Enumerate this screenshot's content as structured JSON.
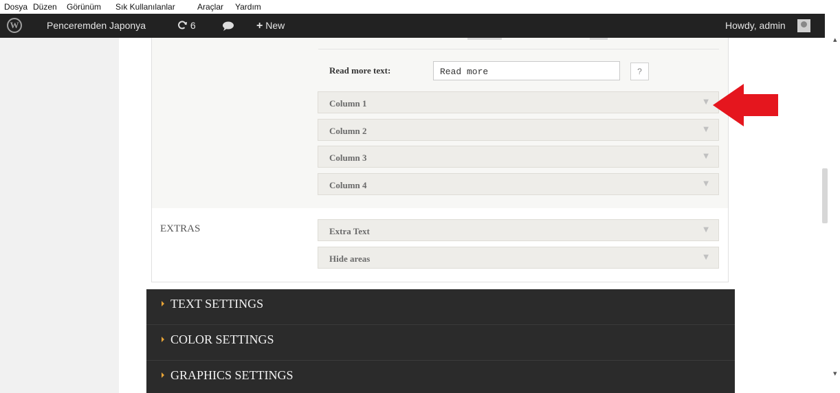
{
  "menubar": {
    "items": [
      "Dosya",
      "Düzen",
      "Görünüm",
      "Sık Kullanılanlar",
      "Araçlar",
      "Yardım"
    ]
  },
  "adminbar": {
    "site_name": "Penceremden Japonya",
    "updates_count": "6",
    "new_label": "New",
    "greeting": "Howdy, admin"
  },
  "settings": {
    "read_more_label": "Read more text:",
    "read_more_value": "Read more",
    "help_label": "?",
    "columns": [
      {
        "label": "Column 1"
      },
      {
        "label": "Column 2"
      },
      {
        "label": "Column 3"
      },
      {
        "label": "Column 4"
      }
    ],
    "extras_label": "EXTRAS",
    "extras_items": [
      {
        "label": "Extra Text"
      },
      {
        "label": "Hide areas"
      }
    ]
  },
  "sections": [
    {
      "label": "TEXT SETTINGS"
    },
    {
      "label": "COLOR SETTINGS"
    },
    {
      "label": "GRAPHICS SETTINGS"
    }
  ],
  "colors": {
    "admin_bar": "#222222",
    "section_bar": "#2b2b2b",
    "section_triangle": "#e8a437",
    "annotation_arrow": "#e5161e"
  }
}
